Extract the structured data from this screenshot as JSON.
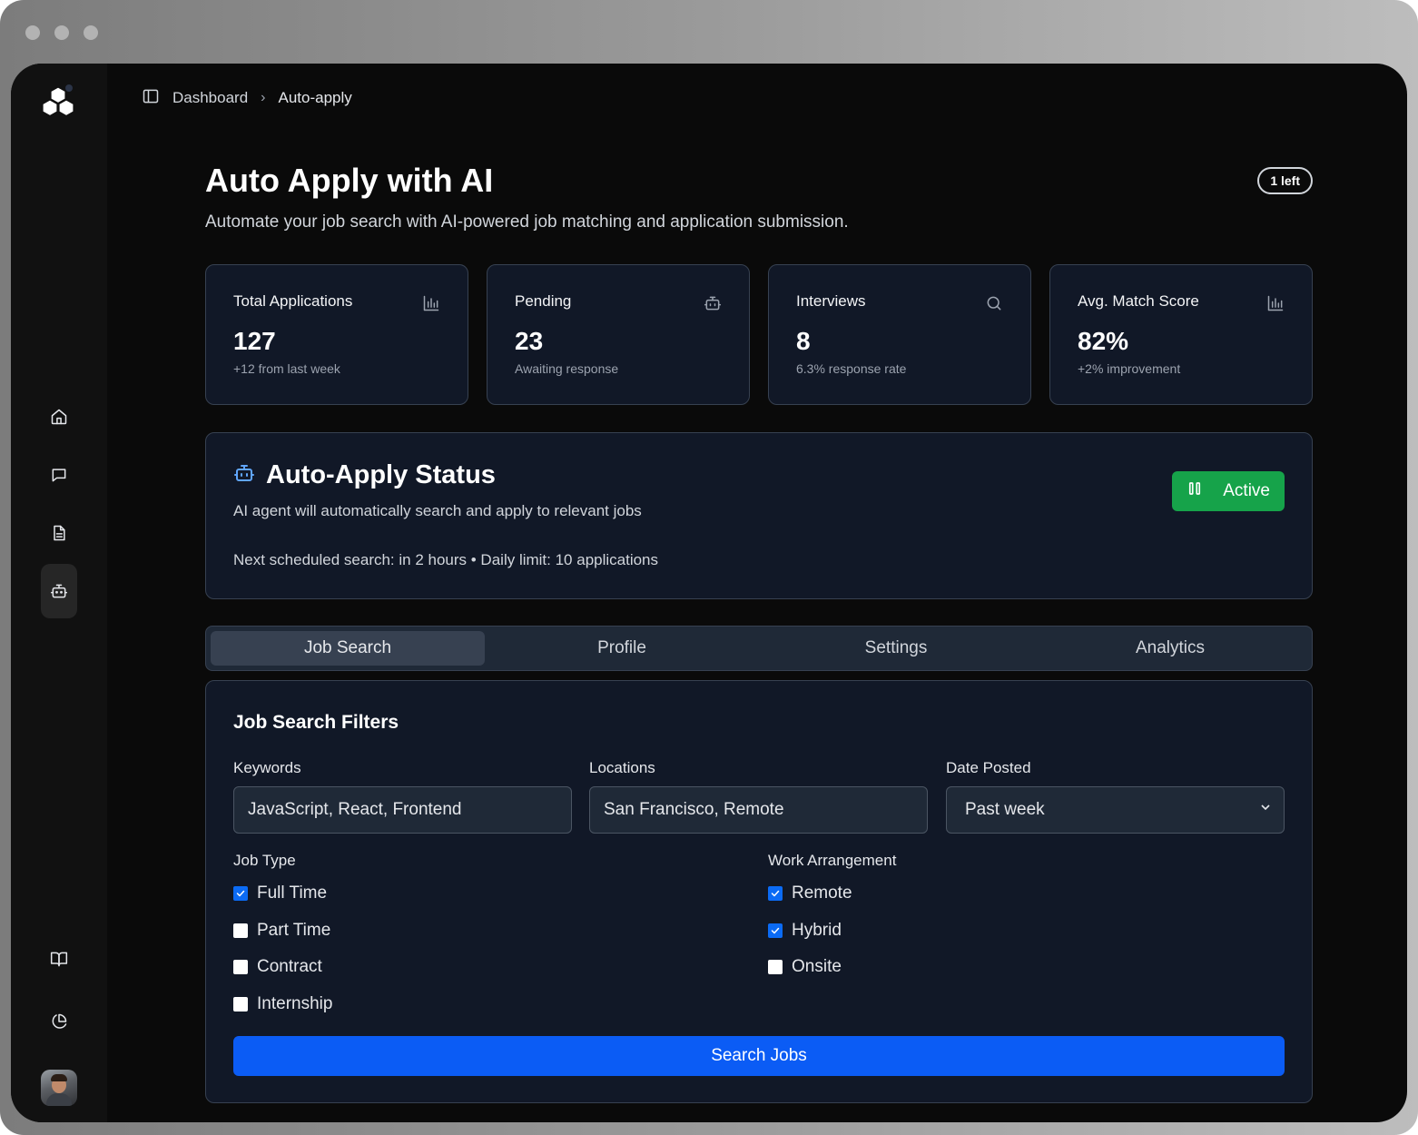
{
  "breadcrumb": {
    "root": "Dashboard",
    "separator": "›",
    "current": "Auto-apply"
  },
  "page": {
    "title": "Auto Apply with AI",
    "subtitle": "Automate your job search with AI-powered job matching and application submission.",
    "credits_badge": "1 left"
  },
  "stats": [
    {
      "label": "Total Applications",
      "value": "127",
      "note": "+12 from last week",
      "icon": "bar-chart-icon"
    },
    {
      "label": "Pending",
      "value": "23",
      "note": "Awaiting response",
      "icon": "bot-icon"
    },
    {
      "label": "Interviews",
      "value": "8",
      "note": "6.3% response rate",
      "icon": "search-icon"
    },
    {
      "label": "Avg. Match Score",
      "value": "82%",
      "note": "+2% improvement",
      "icon": "bar-chart-icon"
    }
  ],
  "status": {
    "title": "Auto-Apply Status",
    "description": "AI agent will automatically search and apply to relevant jobs",
    "meta": "Next scheduled search: in 2 hours • Daily limit: 10 applications",
    "toggle_label": "Active",
    "toggle_color": "#16a34a"
  },
  "tabs": [
    "Job Search",
    "Profile",
    "Settings",
    "Analytics"
  ],
  "filters": {
    "title": "Job Search Filters",
    "keywords": {
      "label": "Keywords",
      "value": "JavaScript, React, Frontend"
    },
    "locations": {
      "label": "Locations",
      "value": "San Francisco, Remote"
    },
    "date_posted": {
      "label": "Date Posted",
      "value": "Past week"
    },
    "job_type": {
      "label": "Job Type",
      "options": [
        {
          "label": "Full Time",
          "checked": true
        },
        {
          "label": "Part Time",
          "checked": false
        },
        {
          "label": "Contract",
          "checked": false
        },
        {
          "label": "Internship",
          "checked": false
        }
      ]
    },
    "work_arrangement": {
      "label": "Work Arrangement",
      "options": [
        {
          "label": "Remote",
          "checked": true
        },
        {
          "label": "Hybrid",
          "checked": true
        },
        {
          "label": "Onsite",
          "checked": false
        }
      ]
    },
    "search_button": "Search Jobs",
    "accent_color": "#0b5cf5"
  }
}
